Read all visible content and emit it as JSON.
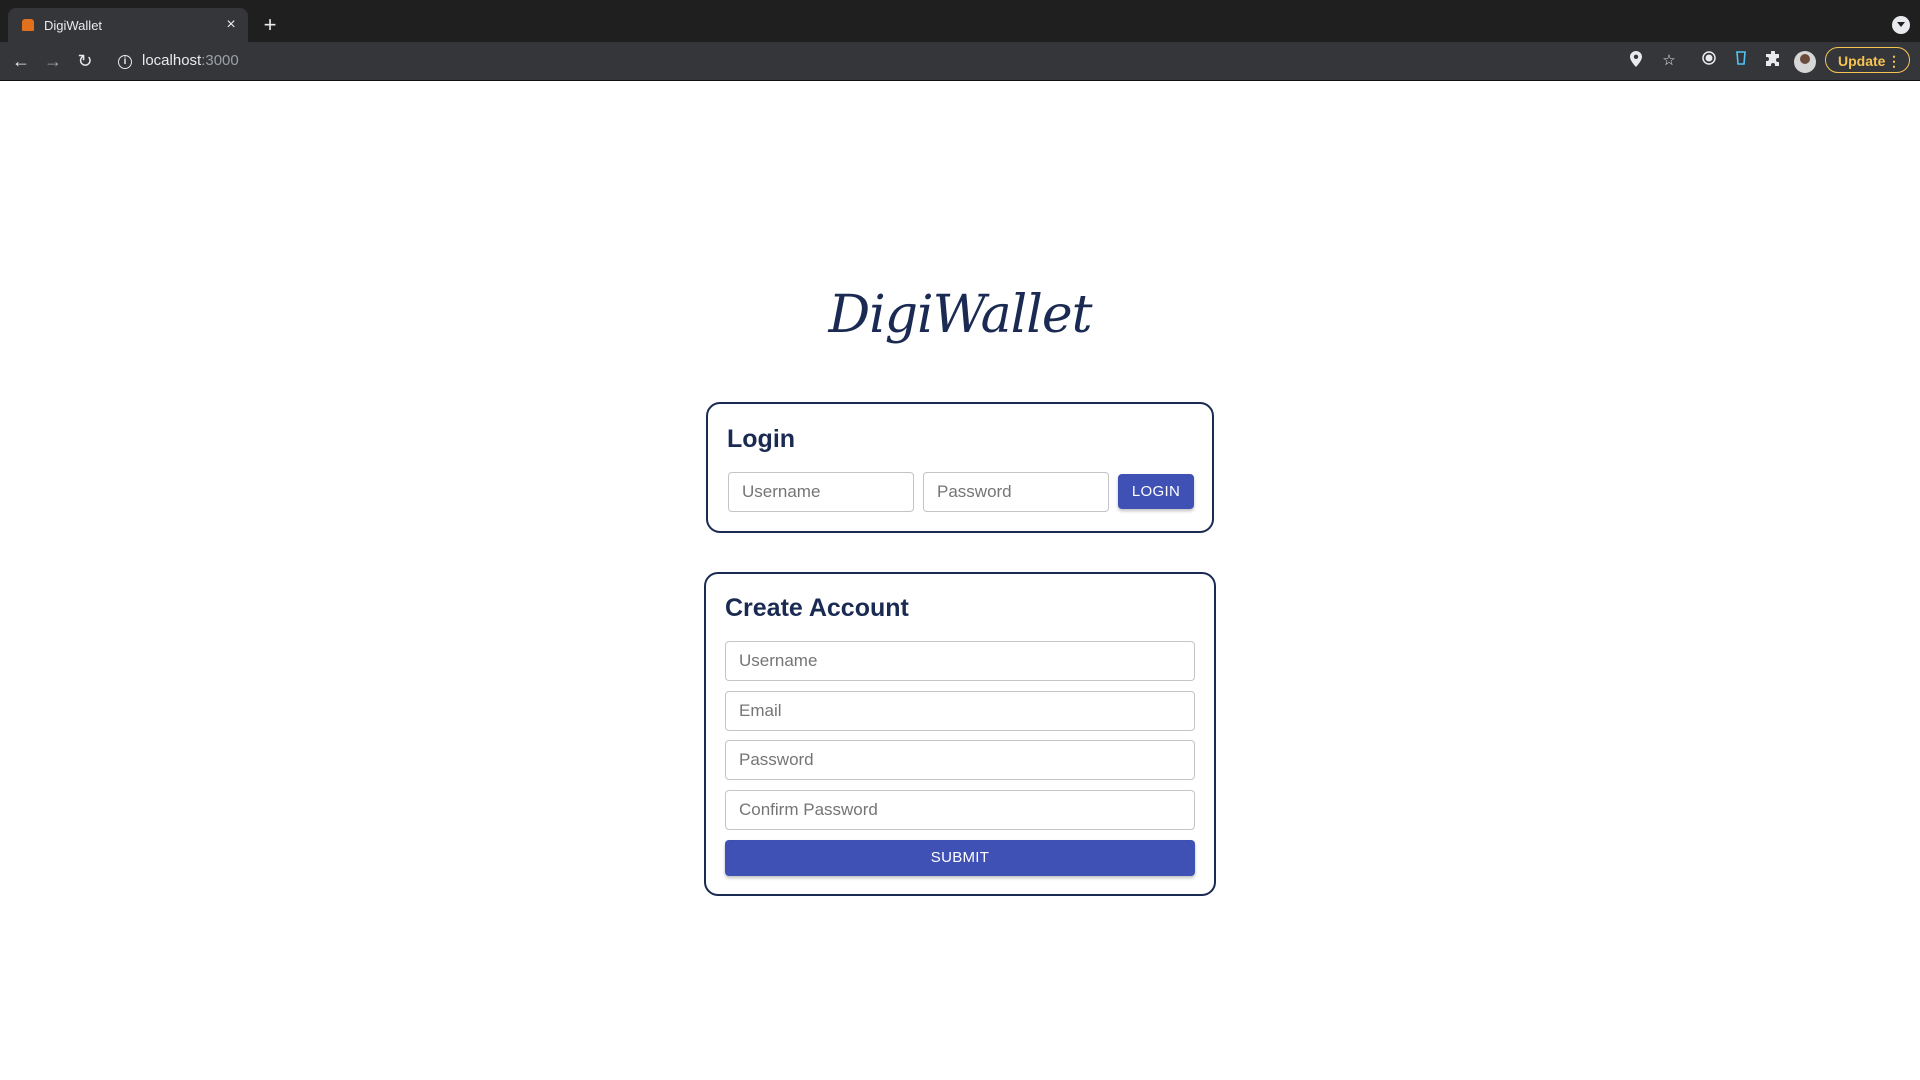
{
  "browser": {
    "tab_title": "DigiWallet",
    "tab_close": "×",
    "new_tab": "+",
    "url_host": "localhost",
    "url_port": ":3000",
    "update_label": "Update",
    "update_menu": "⋮",
    "icons": [
      "back-arrow-icon",
      "forward-arrow-icon",
      "reload-icon",
      "site-info-icon",
      "location-pin-icon",
      "bookmark-star-icon",
      "extension-record-icon",
      "extension-cup-icon",
      "puzzle-extensions-icon",
      "profile-avatar",
      "tab-search-icon"
    ]
  },
  "page": {
    "logo": "DigiWallet",
    "login": {
      "title": "Login",
      "username_placeholder": "Username",
      "password_placeholder": "Password",
      "button_label": "LOGIN"
    },
    "create_account": {
      "title": "Create Account",
      "username_placeholder": "Username",
      "email_placeholder": "Email",
      "password_placeholder": "Password",
      "confirm_password_placeholder": "Confirm Password",
      "button_label": "SUBMIT"
    }
  },
  "colors": {
    "brand_navy": "#1a2a52",
    "button_blue": "#3f51b5",
    "update_accent": "#f6c453"
  }
}
